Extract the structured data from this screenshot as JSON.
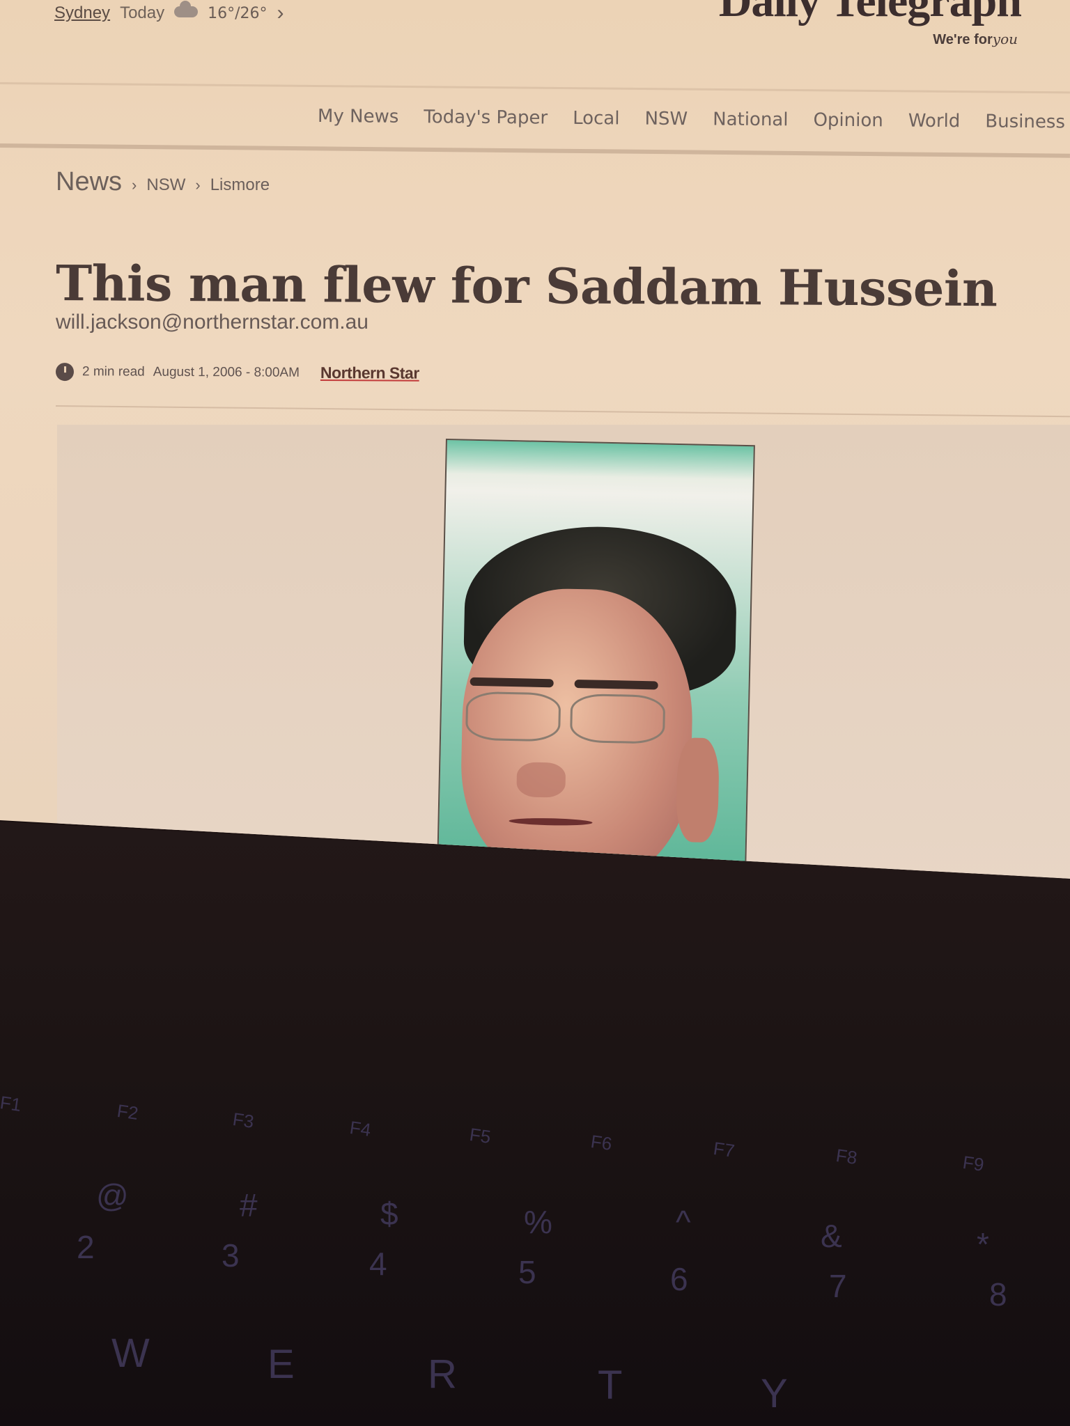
{
  "header": {
    "city": "Sydney",
    "day": "Today",
    "weather_icon": "cloud-icon",
    "temperature": "16°/26°",
    "logo": "Daily Telegraph",
    "tagline_prefix": "We're for",
    "tagline_script": "you"
  },
  "nav": {
    "items": [
      "My News",
      "Today's Paper",
      "Local",
      "NSW",
      "National",
      "Opinion",
      "World",
      "Business"
    ]
  },
  "breadcrumb": {
    "items": [
      "News",
      "NSW",
      "Lismore"
    ]
  },
  "article": {
    "title": "This man flew for Saddam Hussein",
    "byline": "will.jackson@northernstar.com.au",
    "read_time": "2 min read",
    "date": "August 1, 2006 - 8:00AM",
    "source": "Northern Star"
  },
  "keyboard": {
    "fkeys": [
      "F1",
      "F2",
      "F3",
      "F4",
      "F5",
      "F6",
      "F7",
      "F8",
      "F9"
    ],
    "symbols": [
      "@",
      "#",
      "$",
      "%",
      "^",
      "&",
      "*"
    ],
    "numbers": [
      "2",
      "3",
      "4",
      "5",
      "6",
      "7",
      "8"
    ],
    "letters": [
      "W",
      "E",
      "R",
      "T",
      "Y"
    ]
  }
}
